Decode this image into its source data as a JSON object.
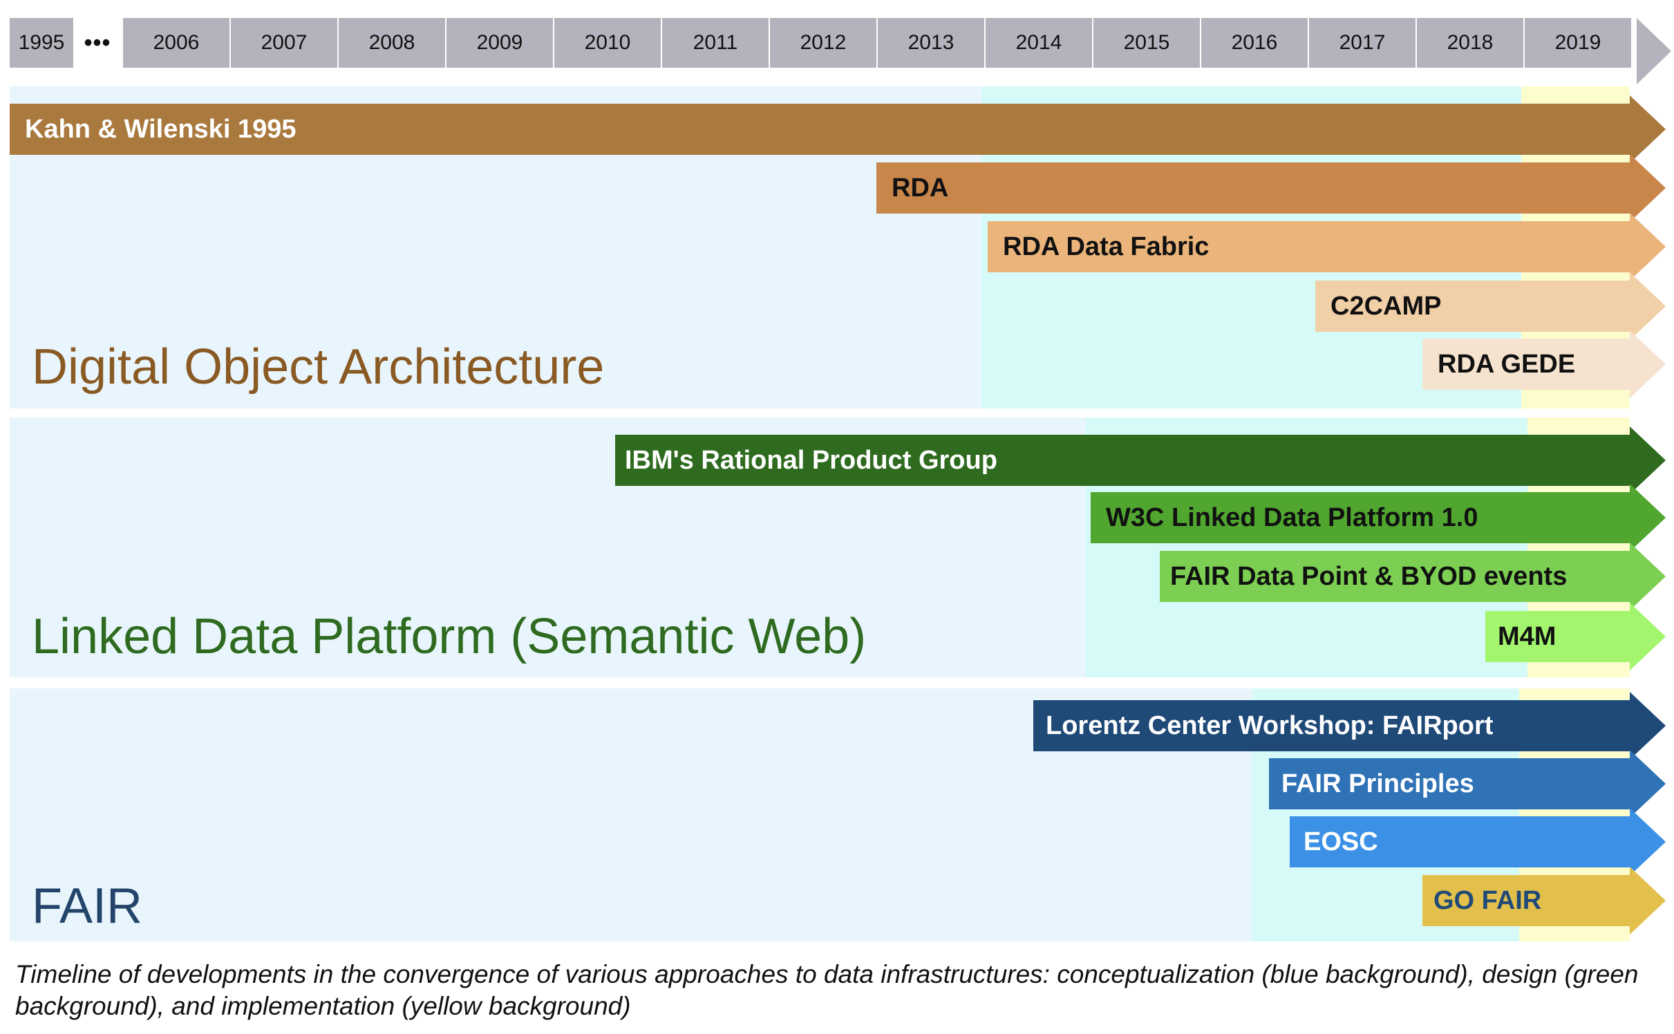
{
  "axis": {
    "first_year": "1995",
    "ellipsis": "•••",
    "years": [
      "2006",
      "2007",
      "2008",
      "2009",
      "2010",
      "2011",
      "2012",
      "2013",
      "2014",
      "2015",
      "2016",
      "2017",
      "2018",
      "2019"
    ],
    "color": "#b3b3bd"
  },
  "phase_colors": {
    "conceptualization": "#e9f5fc",
    "design": "#d6faf7",
    "implementation": "#fdfccd"
  },
  "sections": {
    "doa": {
      "title": "Digital Object Architecture",
      "title_color": "#8a5a24",
      "bars": [
        {
          "label": "Kahn & Wilenski 1995",
          "color": "#a9793d",
          "text_color": "#ffffff"
        },
        {
          "label": "RDA",
          "color": "#c8864a",
          "text_color": "#111111"
        },
        {
          "label": "RDA Data Fabric",
          "color": "#ebb47b",
          "text_color": "#111111"
        },
        {
          "label": "C2CAMP",
          "color": "#f1cfa7",
          "text_color": "#111111"
        },
        {
          "label": "RDA GEDE",
          "color": "#f5e3d0",
          "text_color": "#111111"
        }
      ]
    },
    "ldp": {
      "title": "Linked Data Platform (Semantic Web)",
      "title_color": "#2e6b20",
      "bars": [
        {
          "label": "IBM's Rational Product Group",
          "color": "#2f6b1f",
          "text_color": "#ffffff"
        },
        {
          "label": "W3C Linked Data Platform 1.0",
          "color": "#50a62f",
          "text_color": "#111111"
        },
        {
          "label": "FAIR Data Point & BYOD events",
          "color": "#7ccf52",
          "text_color": "#111111"
        },
        {
          "label": "M4M",
          "color": "#a4f56e",
          "text_color": "#111111"
        }
      ]
    },
    "fair": {
      "title": "FAIR",
      "title_color": "#23446b",
      "bars": [
        {
          "label": "Lorentz Center Workshop: FAIRport",
          "color": "#1f4a78",
          "text_color": "#ffffff"
        },
        {
          "label": "FAIR Principles",
          "color": "#2f72b6",
          "text_color": "#ffffff"
        },
        {
          "label": "EOSC",
          "color": "#3c91e6",
          "text_color": "#ffffff"
        },
        {
          "label": "GO FAIR",
          "color": "#e3bf4c",
          "text_color": "#1f4a78"
        }
      ]
    }
  },
  "caption": "Timeline of developments in the convergence of various approaches to data infrastructures: conceptualization (blue background), design (green background), and implementation (yellow background)"
}
